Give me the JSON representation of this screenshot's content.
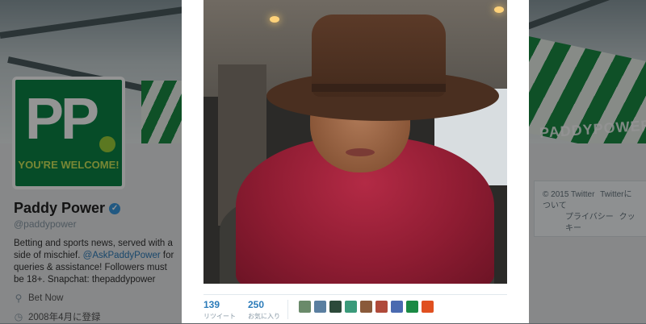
{
  "profile": {
    "avatar_line1": "PP",
    "avatar_slogan": "YOU'RE WELCOME!",
    "banner_tag": "PADDYPOWER",
    "name": "Paddy Power",
    "handle": "@paddypower",
    "bio_before": "Betting and sports news, served with a side of mischief. ",
    "bio_link": "@AskPaddyPower",
    "bio_after": " for queries & assistance! Followers must be 18+. Snapchat: thepaddypower",
    "location": "Bet Now",
    "joined": "2008年4月に登録",
    "verified_icon": "verified-badge-icon"
  },
  "footer": {
    "copyright": "© 2015 Twitter",
    "about": "Twitterについて",
    "privacy": "プライバシー",
    "cookies": "クッキー"
  },
  "tweet": {
    "retweets_count": "139",
    "retweets_label": "リツイート",
    "favorites_count": "250",
    "favorites_label": "お気に入り",
    "liker_colors": [
      "#6a8a6a",
      "#5a7fa0",
      "#2c4a3a",
      "#3a9a7a",
      "#8a5a3a",
      "#b04a3a",
      "#4a6ab0",
      "#1a8a44",
      "#e05020"
    ]
  }
}
